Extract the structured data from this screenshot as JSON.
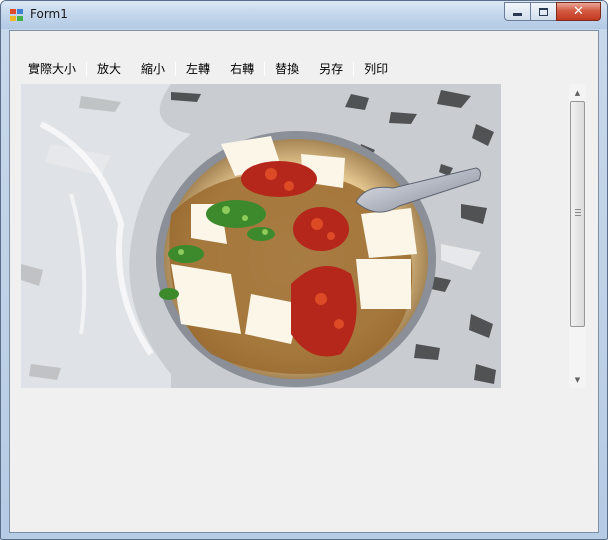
{
  "window": {
    "title": "Form1"
  },
  "menu": {
    "items": [
      {
        "key": "actual-size",
        "label": "實際大小"
      },
      {
        "key": "zoom-in",
        "label": "放大"
      },
      {
        "key": "zoom-out",
        "label": "縮小"
      },
      {
        "key": "rotate-left",
        "label": "左轉"
      },
      {
        "key": "rotate-right",
        "label": "右轉"
      },
      {
        "key": "replace",
        "label": "替換"
      },
      {
        "key": "save-as",
        "label": "另存"
      },
      {
        "key": "print",
        "label": "列印"
      }
    ],
    "separators_after": [
      0,
      2,
      4,
      6
    ]
  },
  "colors": {
    "client_bg": "#f0f0f0",
    "close_button": "#c2391f",
    "titlebar": "#c3d6ec"
  },
  "picture": {
    "subject": "bowl of tofu pudding with chili sauce and spoon"
  }
}
